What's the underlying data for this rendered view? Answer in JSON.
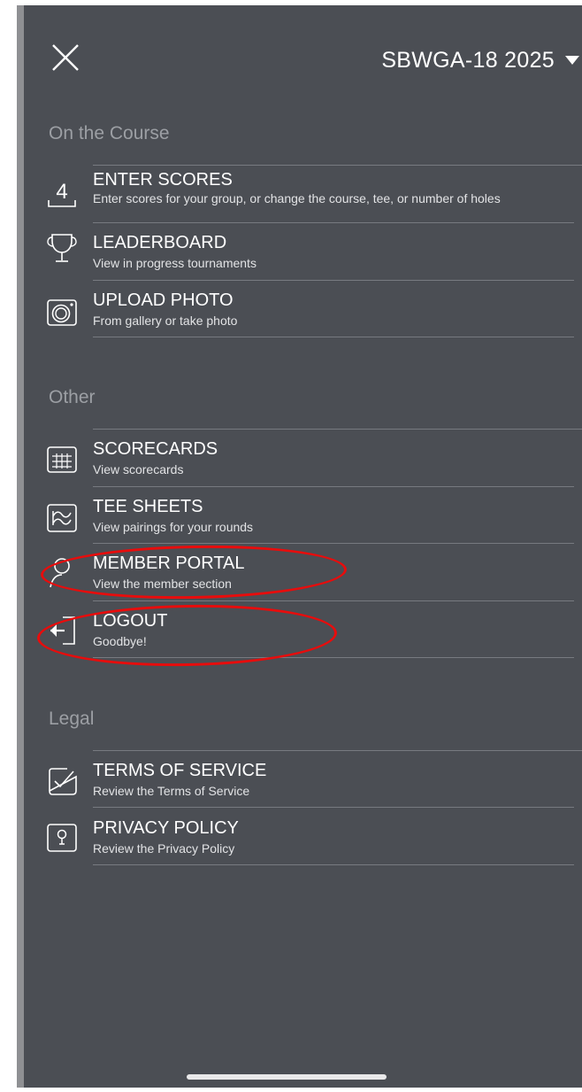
{
  "header": {
    "league_name": "SBWGA-18 2025",
    "close_icon": "close-icon",
    "dropdown_icon": "caret-down-icon"
  },
  "sections": [
    {
      "title": "On the Course",
      "items": [
        {
          "label": "ENTER SCORES",
          "description": "Enter scores for your group, or change the course, tee, or number of holes",
          "icon": "scorecard-number-icon",
          "icon_text": "4"
        },
        {
          "label": "LEADERBOARD",
          "description": "View in progress tournaments",
          "icon": "trophy-icon"
        },
        {
          "label": "UPLOAD PHOTO",
          "description": "From gallery or take photo",
          "icon": "camera-icon"
        }
      ]
    },
    {
      "title": "Other",
      "items": [
        {
          "label": "SCORECARDS",
          "description": "View scorecards",
          "icon": "grid-icon"
        },
        {
          "label": "TEE SHEETS",
          "description": "View pairings for your rounds",
          "icon": "flag-icon"
        },
        {
          "label": "MEMBER PORTAL",
          "description": "View the member section",
          "icon": "person-icon"
        },
        {
          "label": "LOGOUT",
          "description": "Goodbye!",
          "icon": "logout-icon"
        }
      ]
    },
    {
      "title": "Legal",
      "items": [
        {
          "label": "TERMS OF SERVICE",
          "description": "Review the Terms of Service",
          "icon": "checkbox-icon"
        },
        {
          "label": "PRIVACY POLICY",
          "description": "Review the Privacy Policy",
          "icon": "keyhole-icon"
        }
      ]
    }
  ],
  "colors": {
    "background": "#4b4e54",
    "section_title": "#9c9fa4",
    "text": "#ffffff",
    "annotation": "#e80c0c"
  }
}
